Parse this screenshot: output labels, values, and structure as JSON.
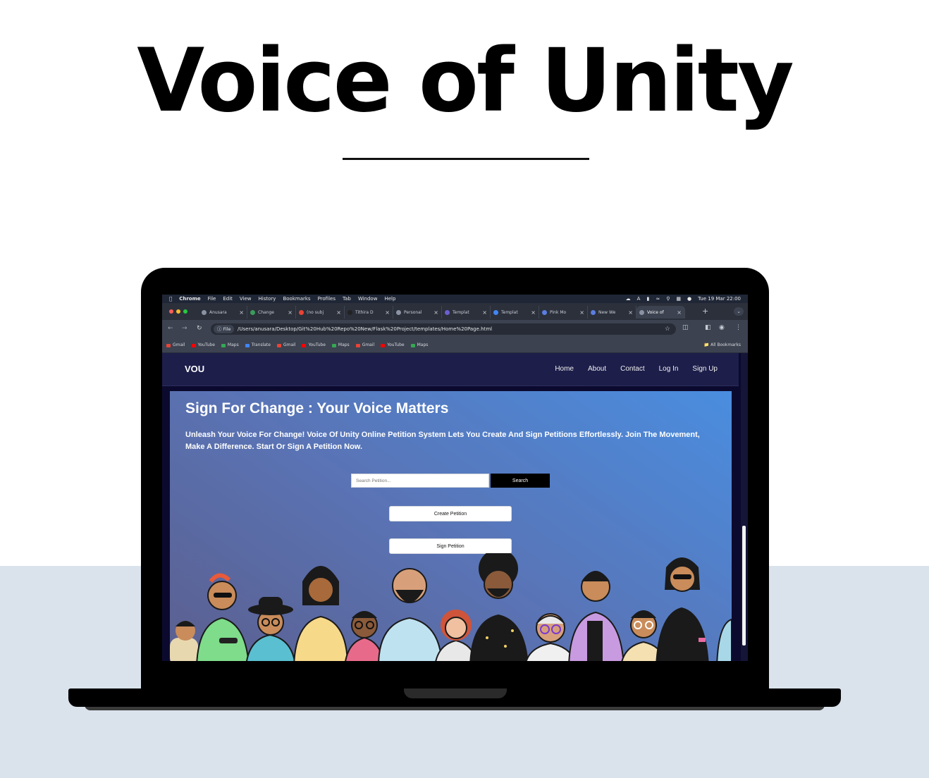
{
  "poster": {
    "title": "Voice of Unity"
  },
  "menubar": {
    "app": "Chrome",
    "items": [
      "File",
      "Edit",
      "View",
      "History",
      "Bookmarks",
      "Profiles",
      "Tab",
      "Window",
      "Help"
    ],
    "datetime": "Tue 19 Mar  22:00"
  },
  "tabs": [
    {
      "label": "Anusara"
    },
    {
      "label": "Change"
    },
    {
      "label": "(no subj"
    },
    {
      "label": "Tithira D"
    },
    {
      "label": "Personal"
    },
    {
      "label": "Templat"
    },
    {
      "label": "Templat"
    },
    {
      "label": "Pink Mo"
    },
    {
      "label": "New We"
    },
    {
      "label": "Voice of"
    }
  ],
  "address": {
    "chip": "File",
    "url": "/Users/anusara/Desktop/Git%20Hub%20Repo%20New/Flask%20Project/templates/Home%20Page.html"
  },
  "bookmarks": {
    "items": [
      {
        "label": "Gmail",
        "color": "#ea4335"
      },
      {
        "label": "YouTube",
        "color": "#ff0000"
      },
      {
        "label": "Maps",
        "color": "#34a853"
      },
      {
        "label": "Translate",
        "color": "#4285f4"
      },
      {
        "label": "Gmail",
        "color": "#ea4335"
      },
      {
        "label": "YouTube",
        "color": "#ff0000"
      },
      {
        "label": "Maps",
        "color": "#34a853"
      },
      {
        "label": "Gmail",
        "color": "#ea4335"
      },
      {
        "label": "YouTube",
        "color": "#ff0000"
      },
      {
        "label": "Maps",
        "color": "#34a853"
      }
    ],
    "all": "All Bookmarks"
  },
  "site": {
    "logo": "VOU",
    "nav": [
      "Home",
      "About",
      "Contact",
      "Log In",
      "Sign Up"
    ],
    "hero_title": "Sign For Change : Your Voice Matters",
    "hero_text": "Unleash Your Voice For Change! Voice Of Unity Online Petition System Lets You Create And Sign Petitions Effortlessly. Join The Movement, Make A Difference. Start Or Sign A Petition Now.",
    "search_placeholder": "Search Petition...",
    "search_button": "Search",
    "create_button": "Create Petition",
    "sign_button": "Sign Petition"
  }
}
